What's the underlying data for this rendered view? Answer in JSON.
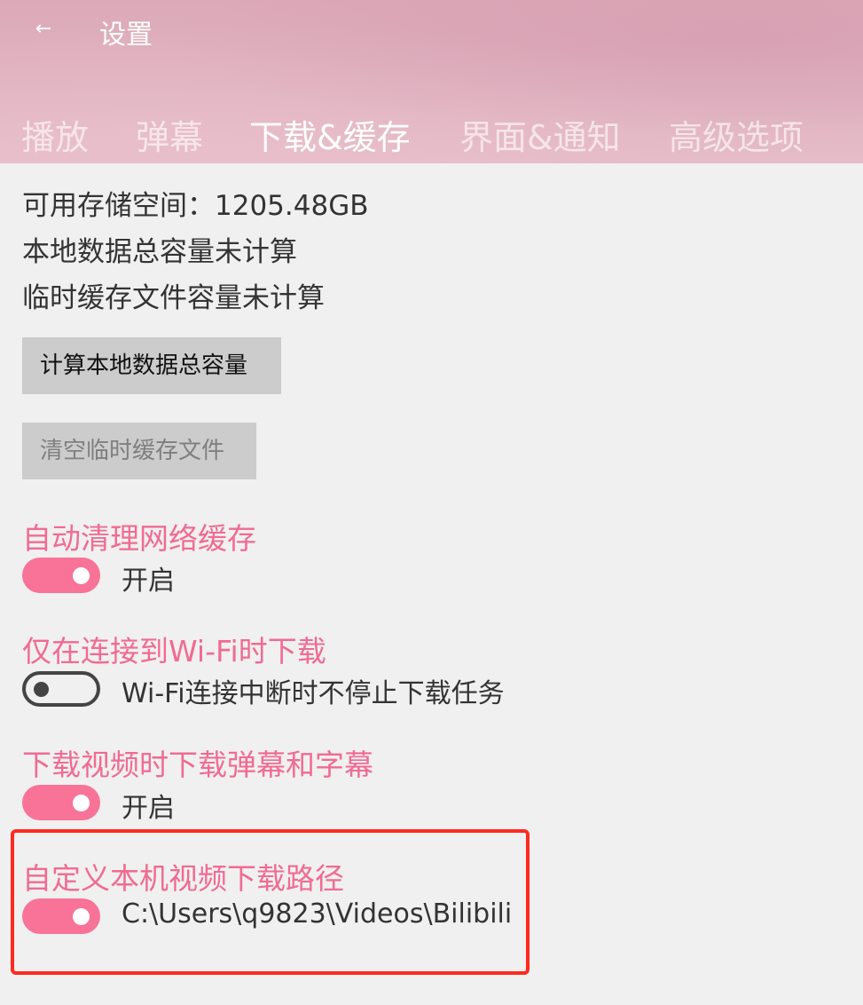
{
  "header": {
    "back_icon": "←",
    "title": "设置",
    "tabs": [
      {
        "label": "播放",
        "active": false
      },
      {
        "label": "弹幕",
        "active": false
      },
      {
        "label": "下载&缓存",
        "active": true
      },
      {
        "label": "界面&通知",
        "active": false
      },
      {
        "label": "高级选项",
        "active": false
      }
    ]
  },
  "storage": {
    "available": "可用存储空间：1205.48GB",
    "local_total": "本地数据总容量未计算",
    "temp_cache": "临时缓存文件容量未计算"
  },
  "buttons": {
    "calc_local": "计算本地数据总容量",
    "clear_temp": "清空临时缓存文件"
  },
  "settings": [
    {
      "title": "自动清理网络缓存",
      "state": "on",
      "label": "开启"
    },
    {
      "title": "仅在连接到Wi-Fi时下载",
      "state": "off",
      "label": "Wi-Fi连接中断时不停止下载任务"
    },
    {
      "title": "下载视频时下载弹幕和字幕",
      "state": "on",
      "label": "开启"
    },
    {
      "title": "自定义本机视频下载路径",
      "state": "on",
      "label": "C:\\Users\\q9823\\Videos\\Bilibili"
    }
  ],
  "colors": {
    "accent": "#f06b92",
    "toggle_on": "#f87397",
    "highlight_border": "#ff2a1f"
  }
}
